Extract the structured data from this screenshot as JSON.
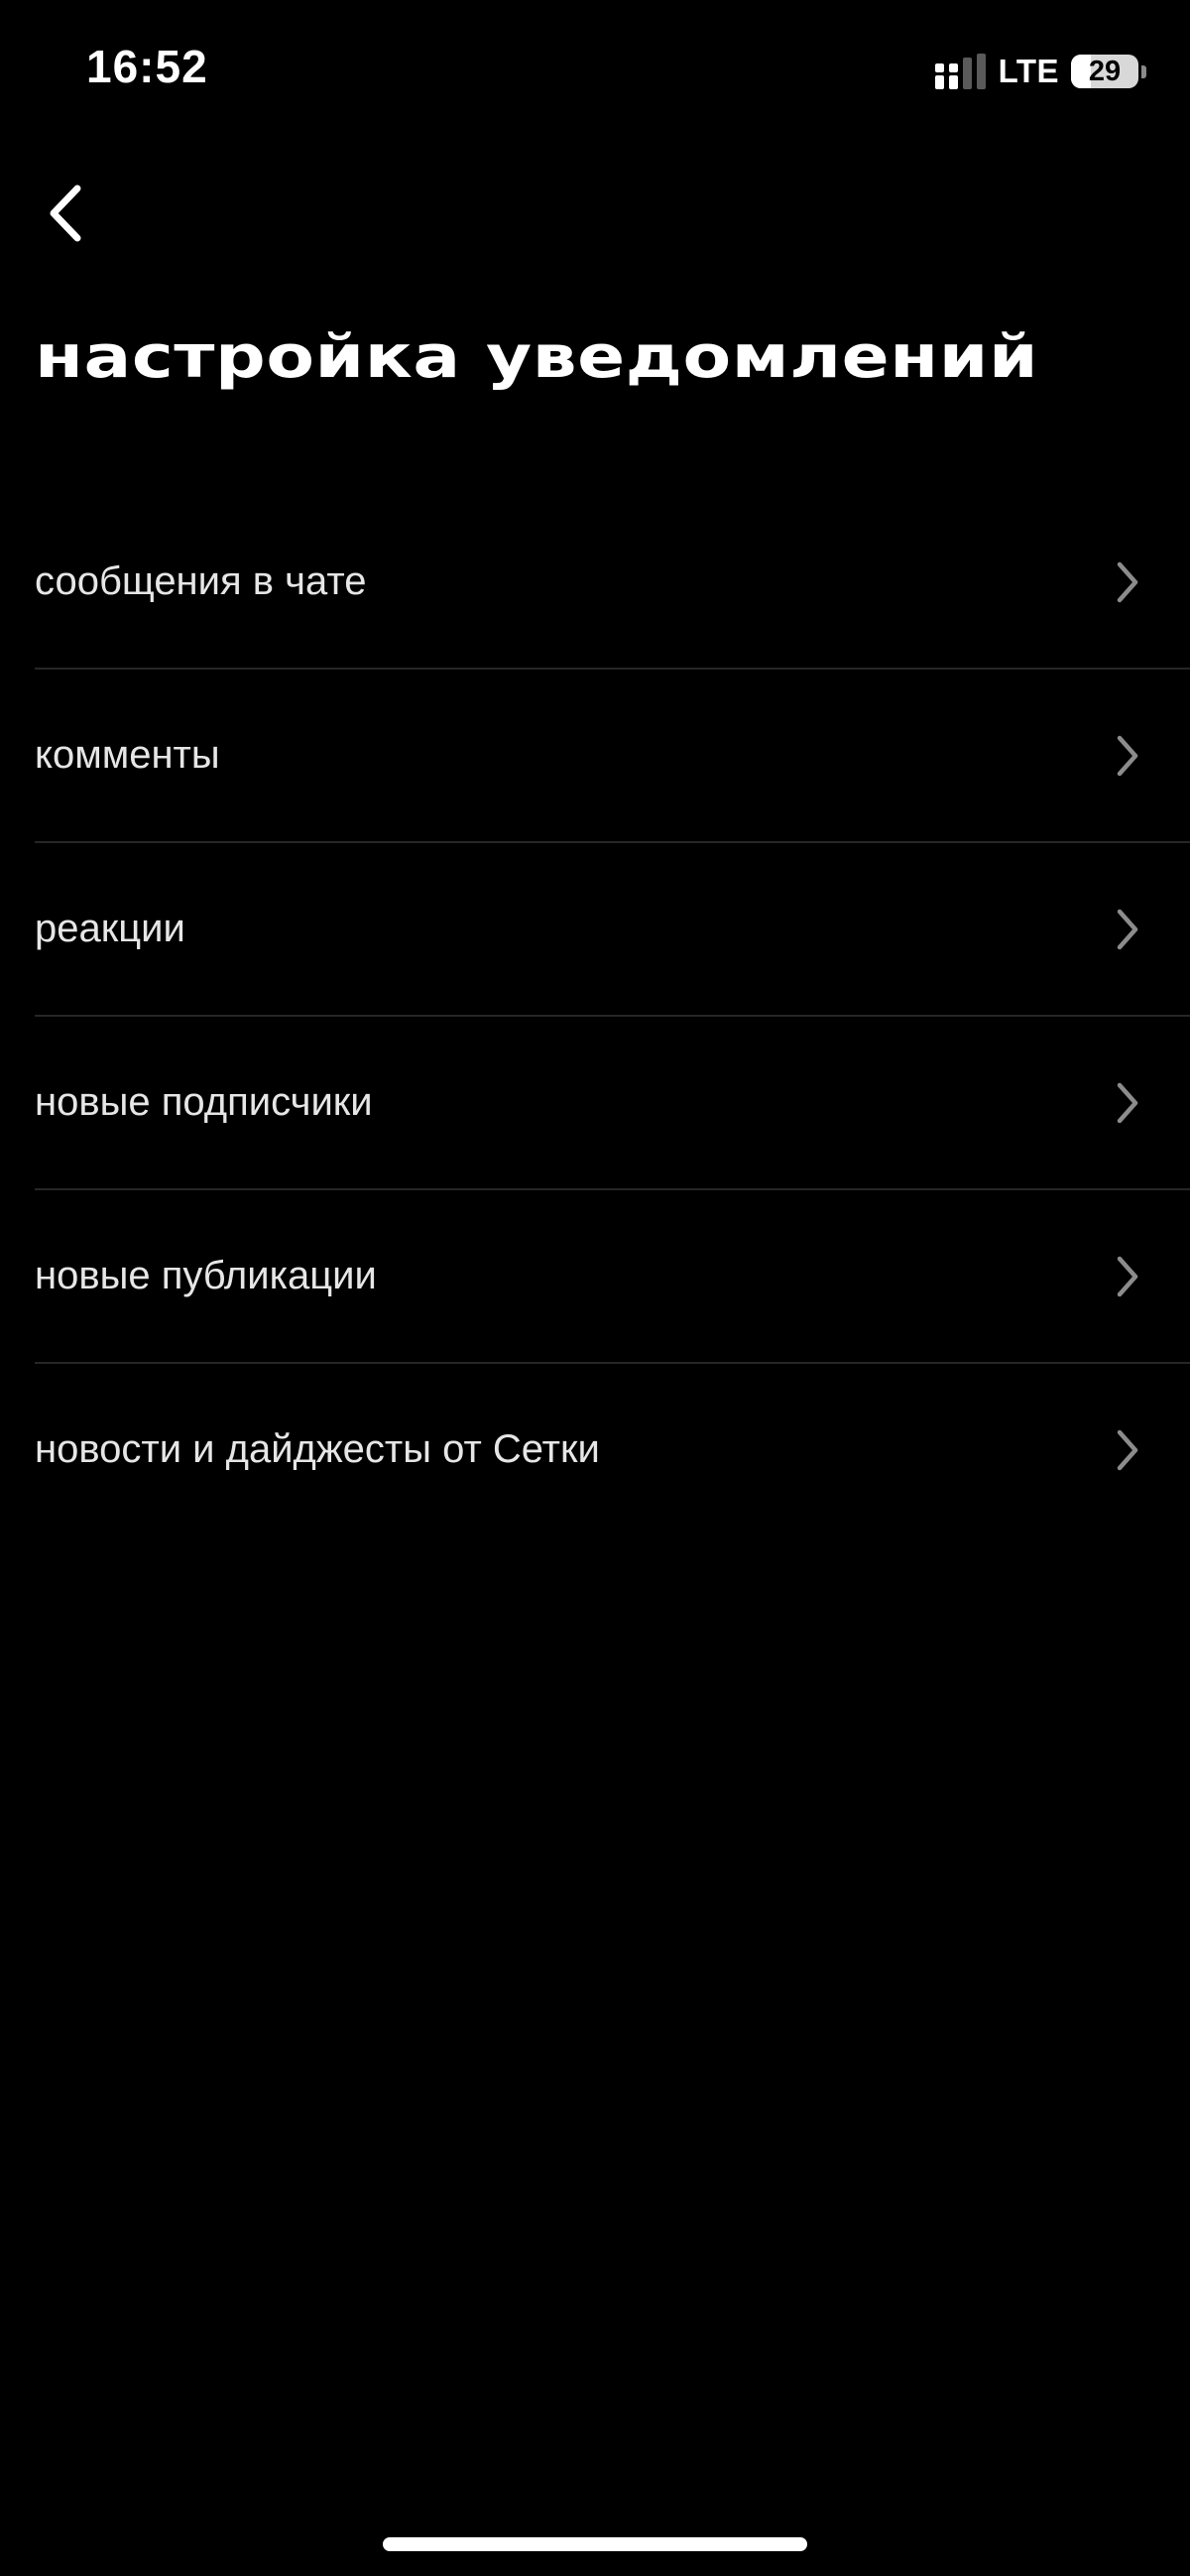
{
  "status_bar": {
    "time": "16:52",
    "network": "LTE",
    "battery_percent": "29",
    "battery_level": 0.29,
    "signal_icon": "cellular-signal-icon"
  },
  "header": {
    "back_icon": "chevron-left-icon",
    "title": "настройка уведомлений"
  },
  "settings": {
    "items": [
      {
        "label": "сообщения в чате",
        "icon": "chevron-right-icon"
      },
      {
        "label": "комменты",
        "icon": "chevron-right-icon"
      },
      {
        "label": "реакции",
        "icon": "chevron-right-icon"
      },
      {
        "label": "новые подписчики",
        "icon": "chevron-right-icon"
      },
      {
        "label": "новые публикации",
        "icon": "chevron-right-icon"
      },
      {
        "label": "новости и дайджесты от Сетки",
        "icon": "chevron-right-icon"
      }
    ]
  },
  "colors": {
    "background": "#000000",
    "text": "#ffffff",
    "item_text": "#e6e6e6",
    "divider": "#262626",
    "chevron": "#8c8c8c"
  }
}
